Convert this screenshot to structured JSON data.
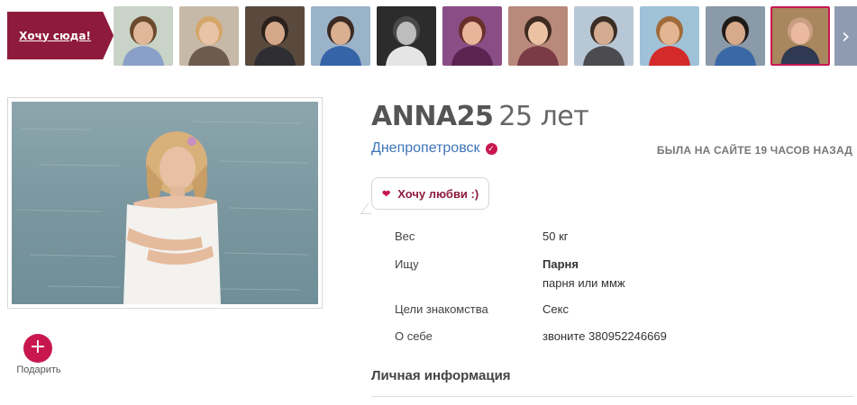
{
  "strip": {
    "want_here_label": "Хочу сюда!",
    "next_icon": "chevron-right-icon",
    "thumbs": [
      {
        "bg": "#c9d3c7",
        "skin": "#e1b79a",
        "hair": "#6b4a2e",
        "shirt": "#8aa0c8"
      },
      {
        "bg": "#c7b9a8",
        "skin": "#e8c3a6",
        "hair": "#d5a66a",
        "shirt": "#6d5b4f"
      },
      {
        "bg": "#5a4a3e",
        "skin": "#d6a88a",
        "hair": "#2b211c",
        "shirt": "#2e2e33"
      },
      {
        "bg": "#9bb3c9",
        "skin": "#d9b092",
        "hair": "#3b2b22",
        "shirt": "#3564a8"
      },
      {
        "bg": "#2c2c2c",
        "skin": "#bdbdbd",
        "hair": "#4a4a4a",
        "shirt": "#e5e5e5"
      },
      {
        "bg": "#8a4d86",
        "skin": "#e7b59a",
        "hair": "#6a2f2b",
        "shirt": "#5b2450"
      },
      {
        "bg": "#b9897c",
        "skin": "#ebc2a4",
        "hair": "#3e2a20",
        "shirt": "#7a3b46"
      },
      {
        "bg": "#b8c7d6",
        "skin": "#d3ab90",
        "hair": "#3a2d24",
        "shirt": "#4b4b50"
      },
      {
        "bg": "#9fc2d8",
        "skin": "#e3b592",
        "hair": "#a06b3a",
        "shirt": "#d42a2a"
      },
      {
        "bg": "#8a9aa8",
        "skin": "#d8aa8c",
        "hair": "#1e1a17",
        "shirt": "#3a67a6"
      },
      {
        "bg": "#a8865e",
        "skin": "#eab9a0",
        "hair": "#c99e82",
        "shirt": "#2f3a52"
      }
    ]
  },
  "profile": {
    "name": "ANNA25",
    "age": "25 лет",
    "city": "Днепропетровск",
    "verified_icon": "check-badge-icon",
    "last_seen": "БЫЛА НА САЙТЕ 19 ЧАСОВ НАЗАД",
    "status": "Хочу любви :)",
    "gift_label": "Подарить",
    "details": {
      "weight_label": "Вес",
      "weight_value": "50 кг",
      "seeking_label": "Ищу",
      "seeking_value": "Парня",
      "seeking_sub": "парня или ммж",
      "goals_label": "Цели знакомства",
      "goals_value": "Секс",
      "about_label": "О себе",
      "about_value": "звоните 380952246669"
    },
    "section_personal": "Личная информация"
  },
  "colors": {
    "brand": "#8e1b3e",
    "accent": "#c8174f",
    "link": "#3d74b8"
  }
}
